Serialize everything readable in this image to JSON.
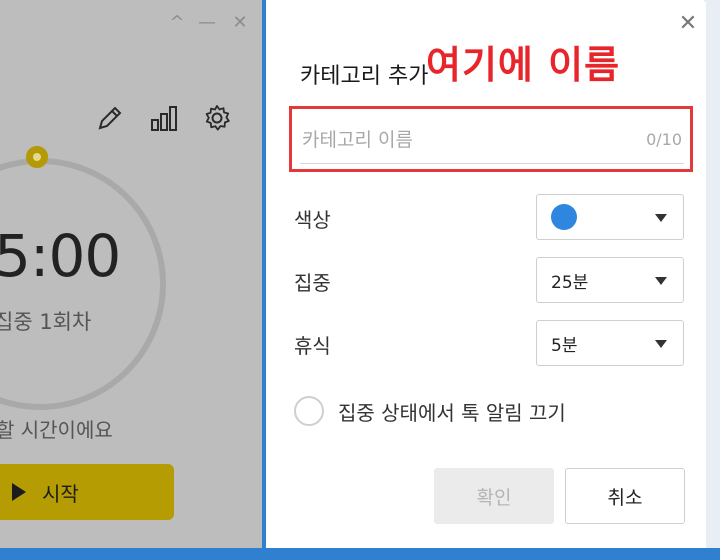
{
  "background_app": {
    "timer": "5:00",
    "session": "집중 1회차",
    "hint": "할 시간이에요",
    "start_label": "시작",
    "window_controls": [
      "^",
      "—",
      "✕"
    ]
  },
  "dialog": {
    "title": "카테고리 추가",
    "close_glyph": "✕",
    "annotation": "여기에 이름",
    "name_field": {
      "placeholder": "카테고리 이름",
      "value": "",
      "counter": "0/10"
    },
    "rows": [
      {
        "label": "색상",
        "type": "color",
        "color": "#2e86de"
      },
      {
        "label": "집중",
        "type": "select",
        "value": "25분"
      },
      {
        "label": "휴식",
        "type": "select",
        "value": "5분"
      }
    ],
    "toggle_label": "집중 상태에서 톡 알림 끄기",
    "confirm_label": "확인",
    "cancel_label": "취소"
  },
  "colors": {
    "accent_blue": "#2e86de",
    "annotation_red": "#e8252a",
    "start_yellow": "#b49c02"
  }
}
